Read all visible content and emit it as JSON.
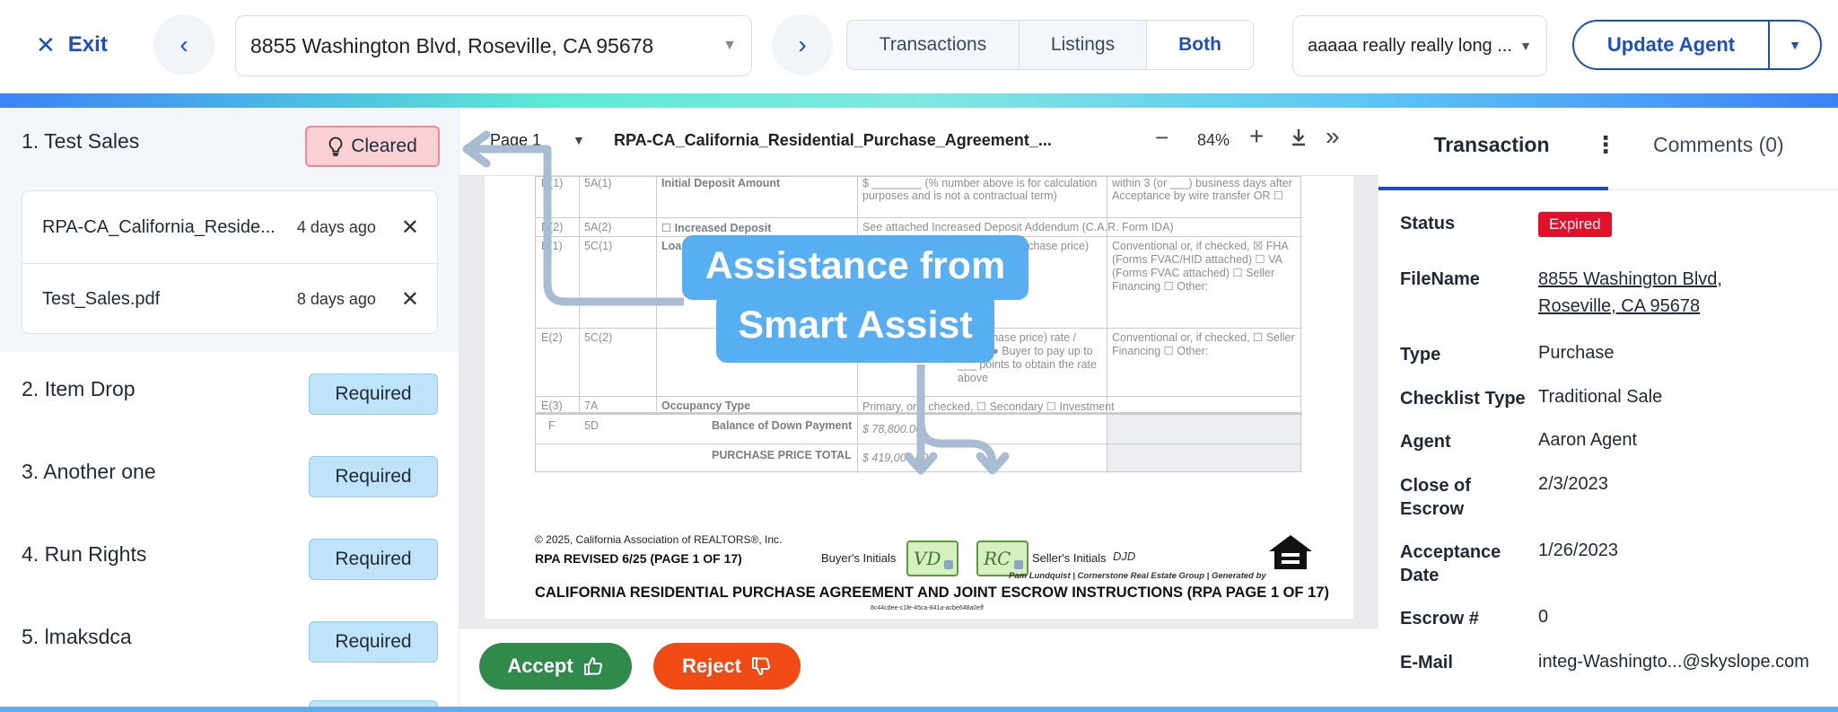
{
  "topbar": {
    "exit_label": "Exit",
    "address": "8855 Washington Blvd, Roseville, CA 95678",
    "view_tabs": [
      "Transactions",
      "Listings",
      "Both"
    ],
    "active_view": "Both",
    "agent_select": "aaaaa really really long ...",
    "update_label": "Update Agent"
  },
  "checklist": {
    "items": [
      {
        "title": "1. Test Sales",
        "status": "Cleared"
      },
      {
        "title": "2. Item Drop",
        "status": "Required"
      },
      {
        "title": "3. Another one",
        "status": "Required"
      },
      {
        "title": "4. Run Rights",
        "status": "Required"
      },
      {
        "title": "5. lmaksdca",
        "status": "Required"
      }
    ],
    "files": [
      {
        "name": "RPA-CA_California_Reside...",
        "date": "4 days ago"
      },
      {
        "name": "Test_Sales.pdf",
        "date": "8 days ago"
      }
    ]
  },
  "viewer": {
    "page_label": "Page 1",
    "doc_name": "RPA-CA_California_Residential_Purchase_Agreement_...",
    "zoom": "84%",
    "accept_label": "Accept",
    "reject_label": "Reject",
    "callout": [
      "Assistance from",
      "Smart Assist"
    ],
    "doc": {
      "rows": [
        {
          "c1": "D(1)",
          "c2": "5A(1)",
          "c3": "Initial Deposit Amount",
          "c4": "$ ________ (% number above is for calculation purposes and is not a contractual term)",
          "c5": "within 3 (or ___) business days after Acceptance by wire transfer OR ☐"
        },
        {
          "c1": "D(2)",
          "c2": "5A(2)",
          "c3": "☐ Increased Deposit",
          "c4": "See attached Increased Deposit Addendum (C.A.R. Form IDA)",
          "c5": ""
        },
        {
          "c1": "E(1)",
          "c2": "5C(1)",
          "c3": "Loan Amount",
          "c4": "purchase price)",
          "c5": "Conventional or, if checked, ☒ FHA (Forms FVAC/HID attached) ☐ VA (Forms FVAC attached) ☐ Seller Financing ☐ Other:"
        },
        {
          "c1": "E(2)",
          "c2": "5C(2)",
          "c3": "",
          "c4": "of purchase price) rate / Points ● Buyer to pay up to ___ points to obtain the rate above",
          "c5": "Conventional or, if checked, ☐ Seller Financing ☐ Other:"
        },
        {
          "c1": "E(3)",
          "c2": "7A",
          "c3": "Occupancy Type",
          "c4": "Primary, or if checked, ☐ Secondary ☐ Investment",
          "c5": ""
        },
        {
          "c1": "F",
          "c2": "5D",
          "c3": "Balance of Down Payment",
          "c4": "$ 78,800.00",
          "c5": ""
        },
        {
          "c1": "",
          "c2": "",
          "c3": "PURCHASE PRICE TOTAL",
          "c4": "$ 419,000.00",
          "c5": ""
        }
      ],
      "copyright": "© 2025, California Association of REALTORS®, Inc.",
      "revised": "RPA REVISED 6/25 (PAGE 1 OF 17)",
      "buyer_initials_label": "Buyer's Initials",
      "seller_initials_label": "Seller's Initials",
      "seller_initials_value": "DJD",
      "initials": [
        "VD",
        "RC"
      ],
      "brokerage": "Pam Lundquist | Cornerstone Real Estate Group | Generated by",
      "title": "CALIFORNIA RESIDENTIAL PURCHASE AGREEMENT AND JOINT ESCROW INSTRUCTIONS (RPA PAGE 1 OF 17)",
      "docid": "8c44cdee-c1fe-45ca-841a-acbe648a0eff"
    }
  },
  "details": {
    "tabs": {
      "transaction": "Transaction",
      "comments": "Comments (0)"
    },
    "fields": [
      {
        "label": "Status",
        "value": "Expired"
      },
      {
        "label": "FileName",
        "value": "8855 Washington Blvd, Roseville, CA 95678"
      },
      {
        "label": "Type",
        "value": "Purchase"
      },
      {
        "label": "Checklist Type",
        "value": "Traditional Sale"
      },
      {
        "label": "Agent",
        "value": "Aaron Agent"
      },
      {
        "label": "Close of Escrow",
        "value": "2/3/2023"
      },
      {
        "label": "Acceptance Date",
        "value": "1/26/2023"
      },
      {
        "label": "Escrow #",
        "value": "0"
      },
      {
        "label": "E-Mail",
        "value": "integ-Washingto...@skyslope.com"
      }
    ]
  },
  "colors": {
    "brand": "#1d4fbf",
    "accept": "#2f8a4c",
    "reject": "#f04b15",
    "expired": "#e3102b",
    "required_bg": "#bfe3f8",
    "cleared_bg": "#fbd1d5",
    "callout_bg": "#57aef0"
  },
  "icons": [
    "close-icon",
    "chevron-left-icon",
    "chevron-right-icon",
    "chevron-down-icon",
    "lightbulb-icon",
    "minus-icon",
    "plus-icon",
    "download-icon",
    "double-chevron-right-icon",
    "kebab-icon",
    "thumbs-up-icon",
    "thumbs-down-icon",
    "equal-housing-icon"
  ]
}
